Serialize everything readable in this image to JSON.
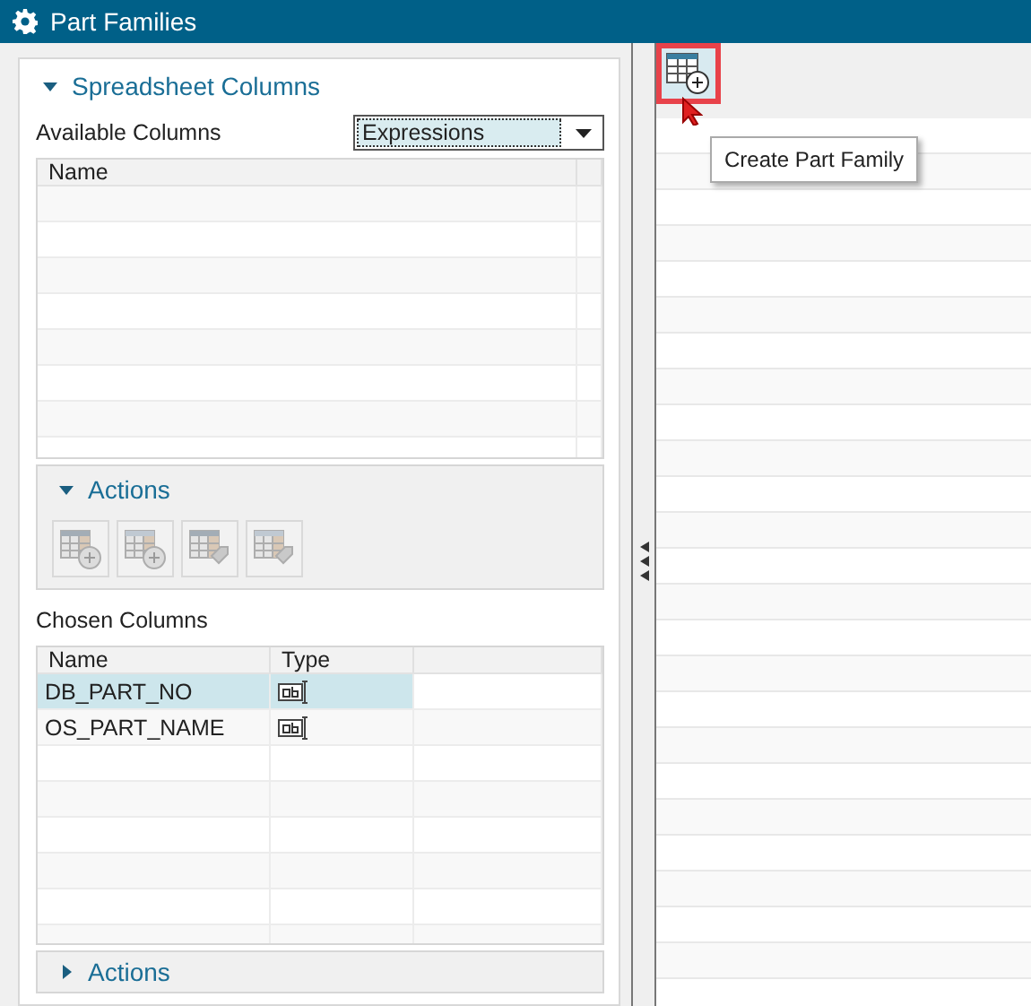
{
  "window": {
    "title": "Part Families"
  },
  "spreadsheet_columns": {
    "title": "Spreadsheet Columns",
    "expanded": true,
    "available_columns": {
      "label": "Available Columns",
      "dropdown": {
        "value": "Expressions"
      }
    },
    "available_table": {
      "columns": [
        "Name"
      ]
    },
    "actions": {
      "title": "Actions",
      "expanded": true,
      "buttons": [
        {
          "kind": "table-add",
          "disabled": true
        },
        {
          "kind": "column-add",
          "disabled": true
        },
        {
          "kind": "table-tag",
          "disabled": true
        },
        {
          "kind": "column-tag",
          "disabled": true
        }
      ]
    },
    "chosen_columns": {
      "label": "Chosen Columns",
      "columns": [
        "Name",
        "Type"
      ],
      "rows": [
        {
          "name": "DB_PART_NO",
          "kind": "text",
          "selected": true
        },
        {
          "name": "OS_PART_NAME",
          "kind": "text",
          "selected": false
        }
      ]
    },
    "actions_2": {
      "title": "Actions",
      "expanded": false
    }
  },
  "toolbar": {
    "create_button": {
      "highlighted": true,
      "tooltip": "Create Part Family"
    }
  }
}
